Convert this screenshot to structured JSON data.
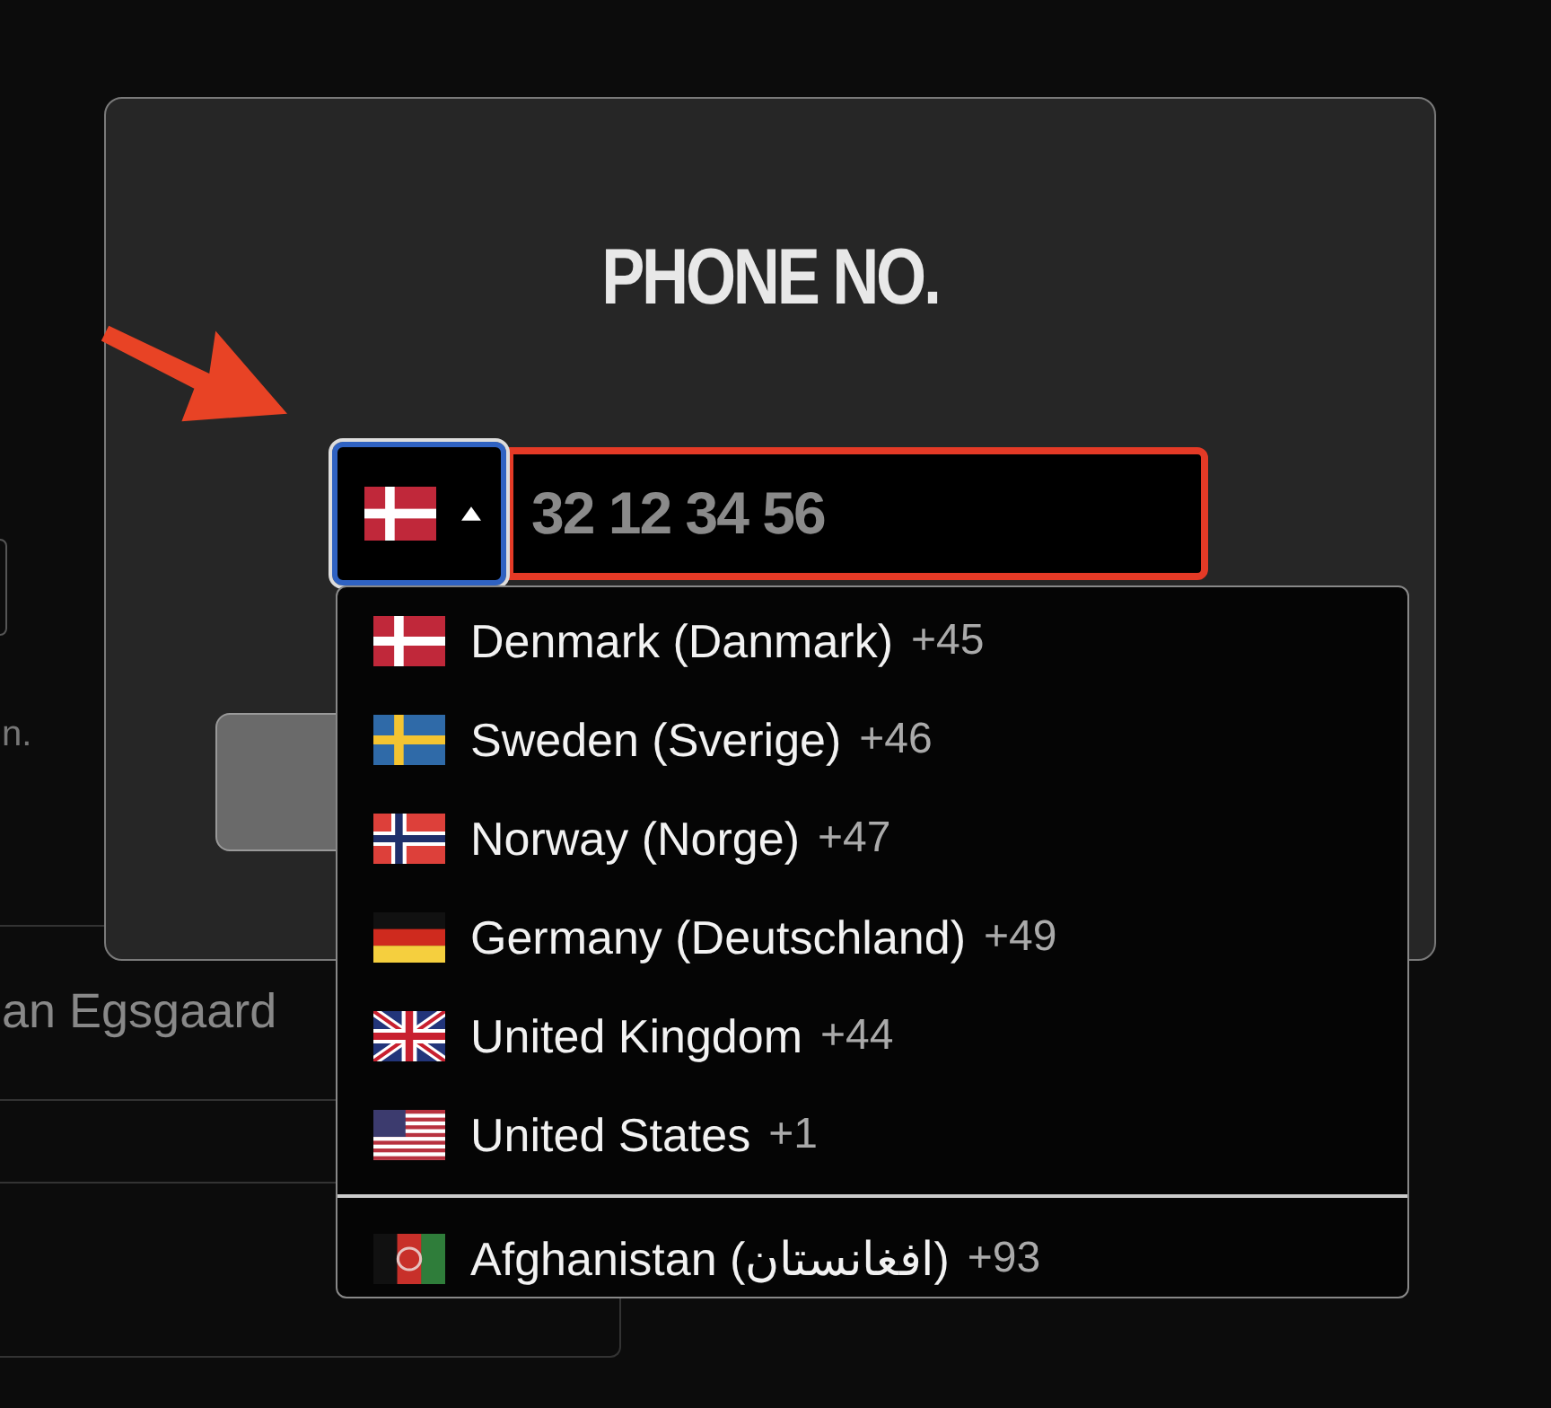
{
  "background": {
    "note_text": "n.",
    "name_text": "an Egsgaard"
  },
  "title": "PHONE NO.",
  "phone_field": {
    "placeholder": "32 12 34 56",
    "invalid": true
  },
  "country_picker": {
    "expanded": true,
    "kind": "dk"
  },
  "countries": [
    {
      "name": "Denmark (Danmark)",
      "code": "+45",
      "kind": "dk"
    },
    {
      "name": "Sweden (Sverige)",
      "code": "+46",
      "kind": "se"
    },
    {
      "name": "Norway (Norge)",
      "code": "+47",
      "kind": "no"
    },
    {
      "name": "Germany (Deutschland)",
      "code": "+49",
      "kind": "de"
    },
    {
      "name": "United Kingdom",
      "code": "+44",
      "kind": "gb"
    },
    {
      "name": "United States",
      "code": "+1",
      "kind": "us",
      "divider_after": true
    },
    {
      "name": "Afghanistan (افغانستان)",
      "code": "+93",
      "kind": "af"
    }
  ]
}
